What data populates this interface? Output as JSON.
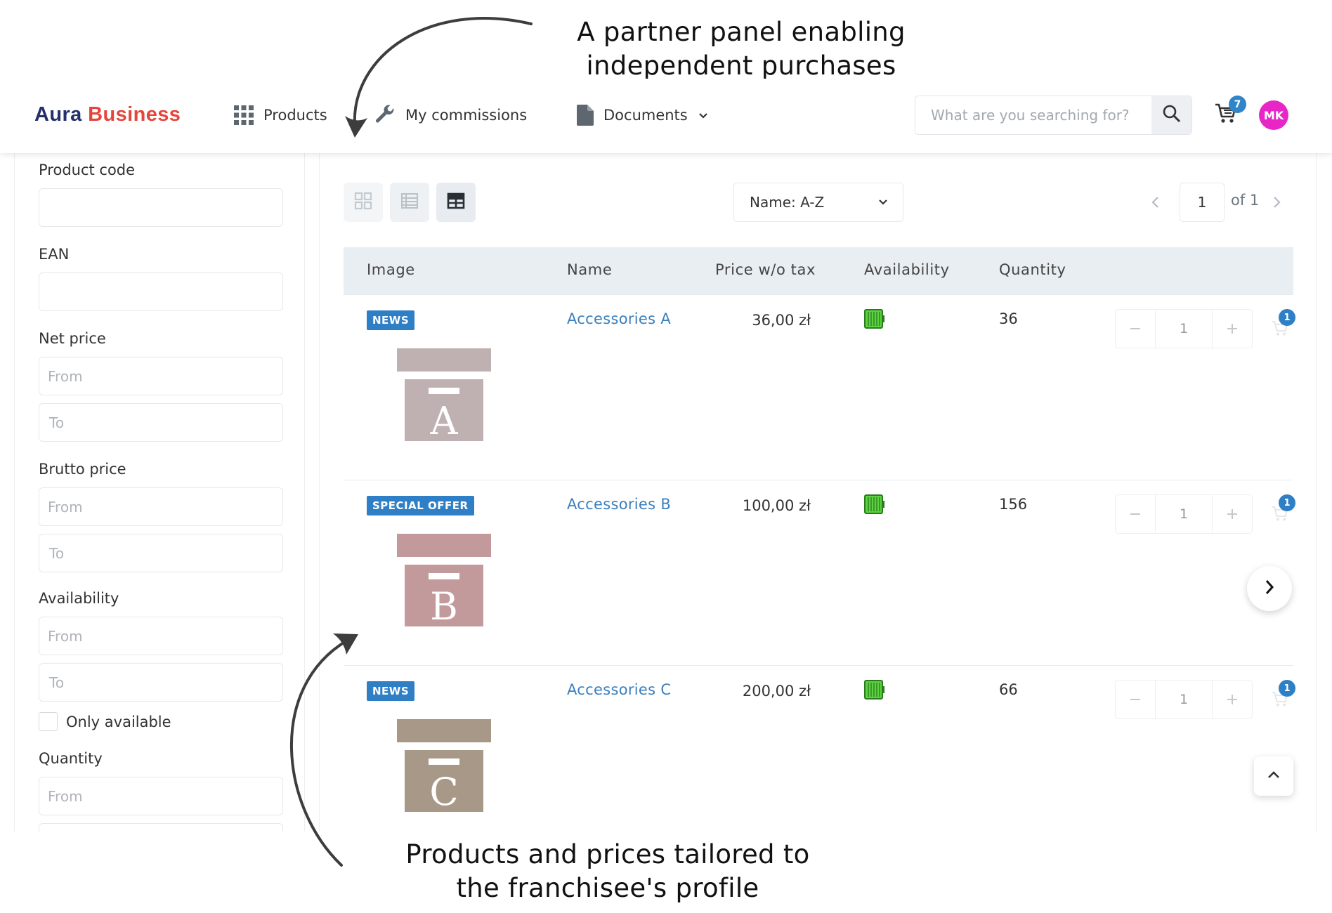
{
  "annotations": {
    "top": "A partner panel enabling independent purchases",
    "bottom": "Products and prices tailored to the franchisee's profile"
  },
  "header": {
    "logo_part1": "Aura",
    "logo_part2": "Business",
    "nav": {
      "products": "Products",
      "commissions": "My commissions",
      "documents": "Documents"
    },
    "search_placeholder": "What are you searching for?",
    "cart_count": "7",
    "avatar_initials": "MK",
    "accent_color": "#e4463c",
    "brand_color": "#24306b"
  },
  "filters": {
    "product_code": {
      "label": "Product code",
      "value": ""
    },
    "ean": {
      "label": "EAN",
      "value": ""
    },
    "net_price": {
      "label": "Net price",
      "from": "From",
      "to": "To"
    },
    "brutto_price": {
      "label": "Brutto price",
      "from": "From",
      "to": "To"
    },
    "availability": {
      "label": "Availability",
      "from": "From",
      "to": "To"
    },
    "only_available": "Only available",
    "quantity": {
      "label": "Quantity",
      "from": "From"
    }
  },
  "toolbar": {
    "sort_value": "Name: A-Z",
    "page_current": "1",
    "page_of": "of 1"
  },
  "table": {
    "columns": [
      "Image",
      "Name",
      "Price w/o tax",
      "Availability",
      "Quantity"
    ],
    "rows": [
      {
        "badge": "NEWS",
        "letter": "A",
        "name": "Accessories A",
        "price": "36,00 zł",
        "quantity": "36",
        "stepper_value": "1",
        "cart_badge": "1",
        "box_color": "#bfb1b1"
      },
      {
        "badge": "SPECIAL OFFER",
        "letter": "B",
        "name": "Accessories B",
        "price": "100,00 zł",
        "quantity": "156",
        "stepper_value": "1",
        "cart_badge": "1",
        "box_color": "#c39a9c"
      },
      {
        "badge": "NEWS",
        "letter": "C",
        "name": "Accessories C",
        "price": "200,00 zł",
        "quantity": "66",
        "stepper_value": "1",
        "cart_badge": "1",
        "box_color": "#a89888"
      }
    ]
  },
  "icons": {
    "products": "grid-icon",
    "commissions": "wrench-icon",
    "documents": "document-icon",
    "availability": "battery-full-icon"
  }
}
